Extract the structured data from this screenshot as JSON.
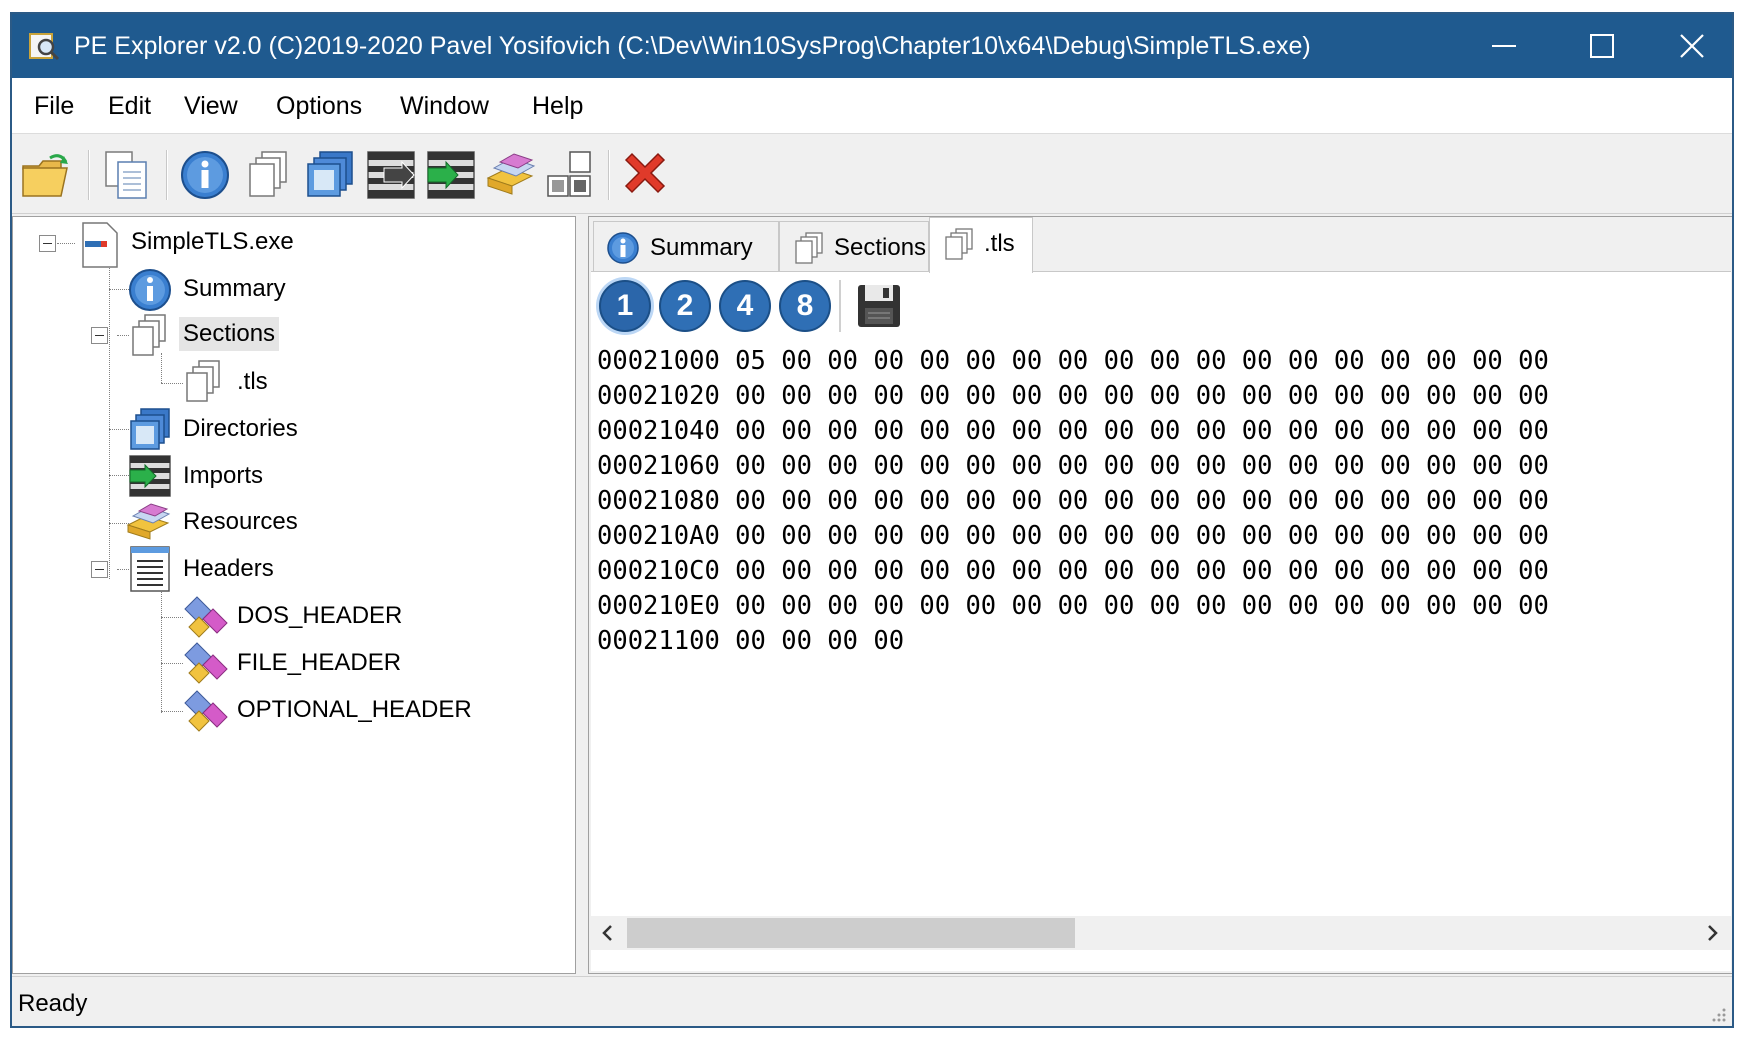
{
  "window": {
    "title": "PE Explorer v2.0 (C)2019-2020 Pavel Yosifovich (C:\\Dev\\Win10SysProg\\Chapter10\\x64\\Debug\\SimpleTLS.exe)"
  },
  "menu": [
    "File",
    "Edit",
    "View",
    "Options",
    "Window",
    "Help"
  ],
  "toolbar": {
    "icons": [
      "open-folder-icon",
      "copy-icon",
      "info-icon",
      "sections-icon",
      "directories-icon",
      "exports-icon",
      "imports-icon",
      "resources-icon",
      "headers-icon",
      "close-file-icon"
    ]
  },
  "tree": {
    "root": "SimpleTLS.exe",
    "summary": "Summary",
    "sections": "Sections",
    "tls": ".tls",
    "directories": "Directories",
    "imports": "Imports",
    "resources": "Resources",
    "headers": "Headers",
    "dos_header": "DOS_HEADER",
    "file_header": "FILE_HEADER",
    "optional_header": "OPTIONAL_HEADER"
  },
  "tabs": [
    "Summary",
    "Sections",
    ".tls"
  ],
  "active_tab": ".tls",
  "size_buttons": [
    "1",
    "2",
    "4",
    "8"
  ],
  "hex_rows": [
    "00021000 05 00 00 00 00 00 00 00 00 00 00 00 00 00 00 00 00 00",
    "00021020 00 00 00 00 00 00 00 00 00 00 00 00 00 00 00 00 00 00",
    "00021040 00 00 00 00 00 00 00 00 00 00 00 00 00 00 00 00 00 00",
    "00021060 00 00 00 00 00 00 00 00 00 00 00 00 00 00 00 00 00 00",
    "00021080 00 00 00 00 00 00 00 00 00 00 00 00 00 00 00 00 00 00",
    "000210A0 00 00 00 00 00 00 00 00 00 00 00 00 00 00 00 00 00 00",
    "000210C0 00 00 00 00 00 00 00 00 00 00 00 00 00 00 00 00 00 00",
    "000210E0 00 00 00 00 00 00 00 00 00 00 00 00 00 00 00 00 00 00",
    "00021100 00 00 00 00"
  ],
  "status": "Ready",
  "colors": {
    "titlebar": "#1f5a8f",
    "accent": "#2f6fb5"
  }
}
